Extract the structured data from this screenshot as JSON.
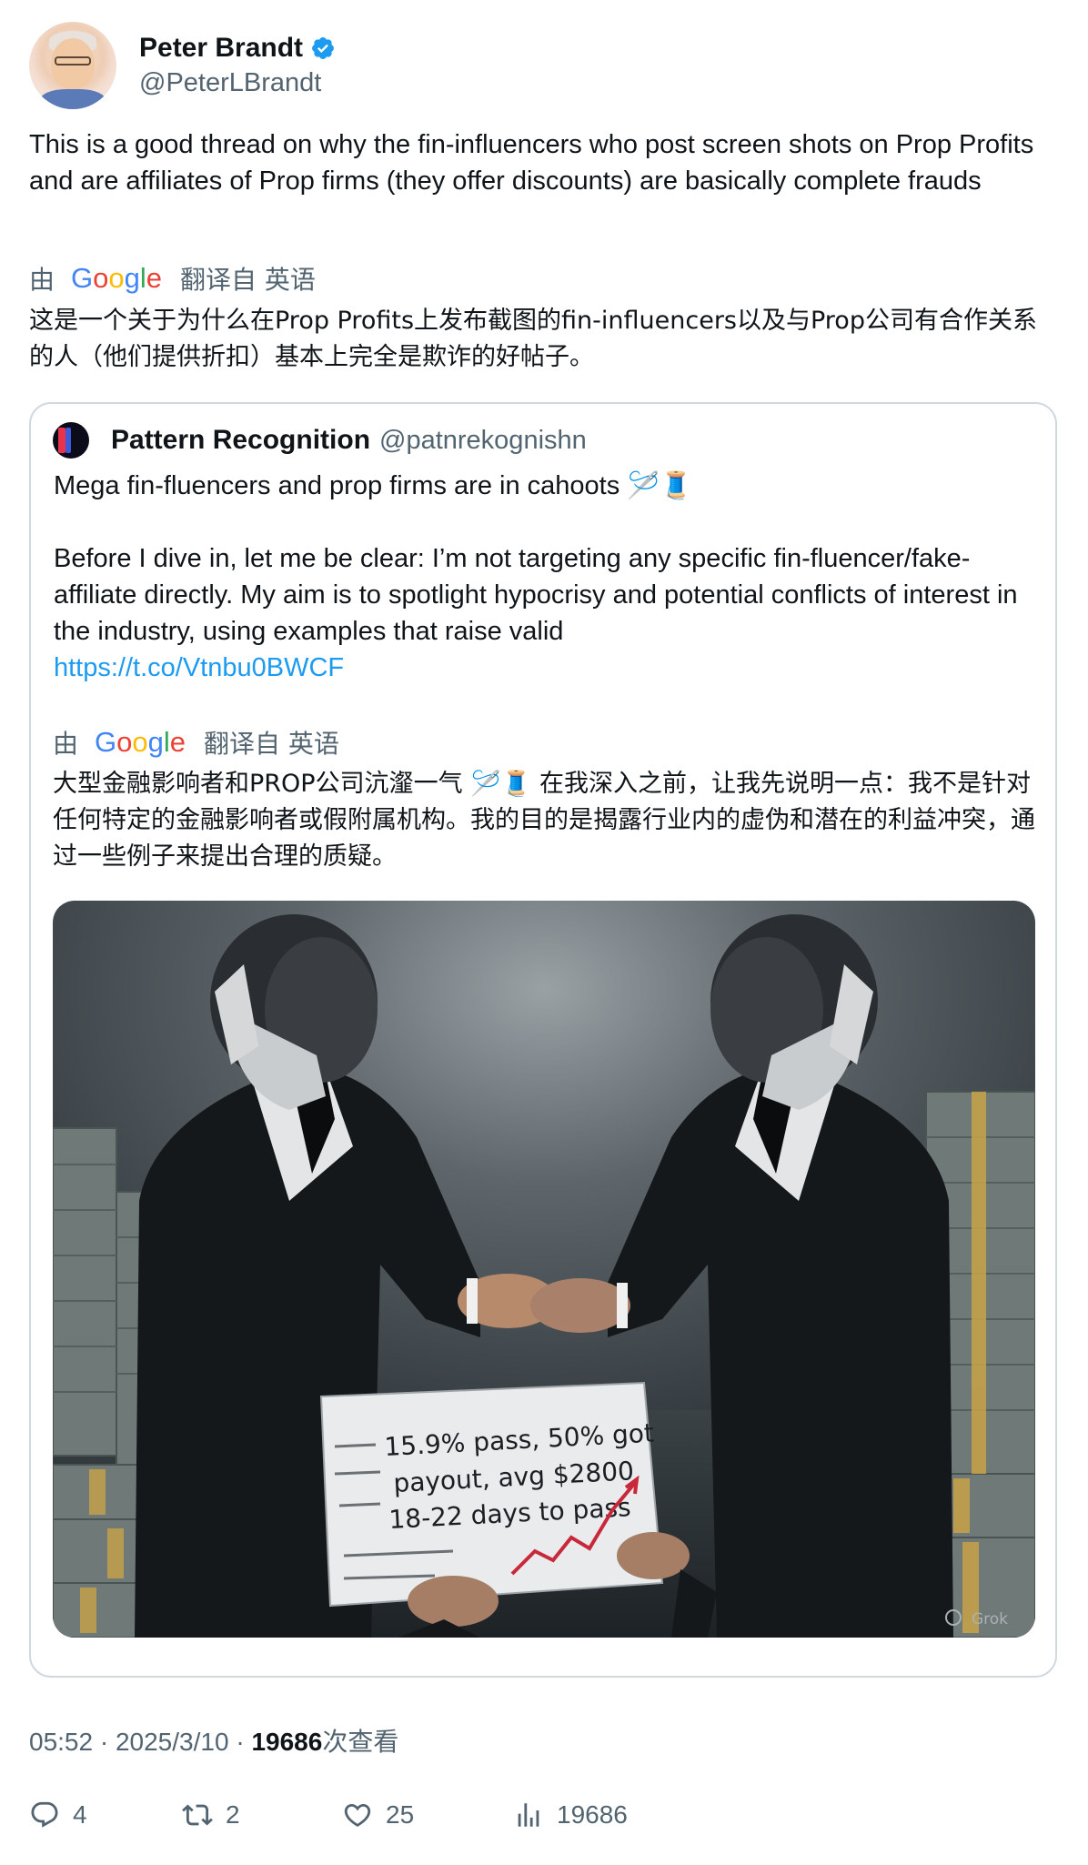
{
  "author": {
    "name": "Peter Brandt",
    "handle": "@PeterLBrandt",
    "verified": true
  },
  "tweet": {
    "text": "This is a good thread on why the fin-influencers who post screen shots on Prop Profits and are affiliates of Prop firms (they offer discounts) are basically complete frauds",
    "translation_by": "由",
    "translation_source": "翻译自 英语",
    "translated_text": "这是一个关于为什么在Prop Profits上发布截图的fin-influencers以及与Prop公司有合作关系的人（他们提供折扣）基本上完全是欺诈的好帖子。"
  },
  "quoted": {
    "name": "Pattern Recognition",
    "handle": "@patnrekognishn",
    "text_line1": "Mega fin-fluencers and prop firms are in cahoots 🪡🧵",
    "text_body": "Before I dive in, let me be clear: I’m not targeting any specific fin-fluencer/fake-affiliate directly. My aim is to spotlight hypocrisy and potential conflicts of interest in the industry, using examples that raise valid",
    "link": "https://t.co/Vtnbu0BWCF",
    "translation_by": "由",
    "translation_source": "翻译自 英语",
    "translated_text": "大型金融影响者和PROP公司沆瀣一气 🪡🧵 在我深入之前，让我先说明一点：我不是针对任何特定的金融影响者或假附属机构。我的目的是揭露行业内的虚伪和潜在的利益冲突，通过一些例子来提出合理的质疑。",
    "image": {
      "sign_line1": "15.9% pass, 50% got",
      "sign_line2": "payout, avg $2800",
      "sign_line3": "18-22 days to pass",
      "watermark": "Grok"
    }
  },
  "meta": {
    "time": "05:52",
    "date": "2025/3/10",
    "views": "19686",
    "views_label": "次查看"
  },
  "actions": {
    "replies": "4",
    "reposts": "2",
    "likes": "25",
    "views": "19686"
  },
  "colors": {
    "link": "#1d9bf0",
    "secondary": "#536471",
    "border": "#cfd9de"
  }
}
